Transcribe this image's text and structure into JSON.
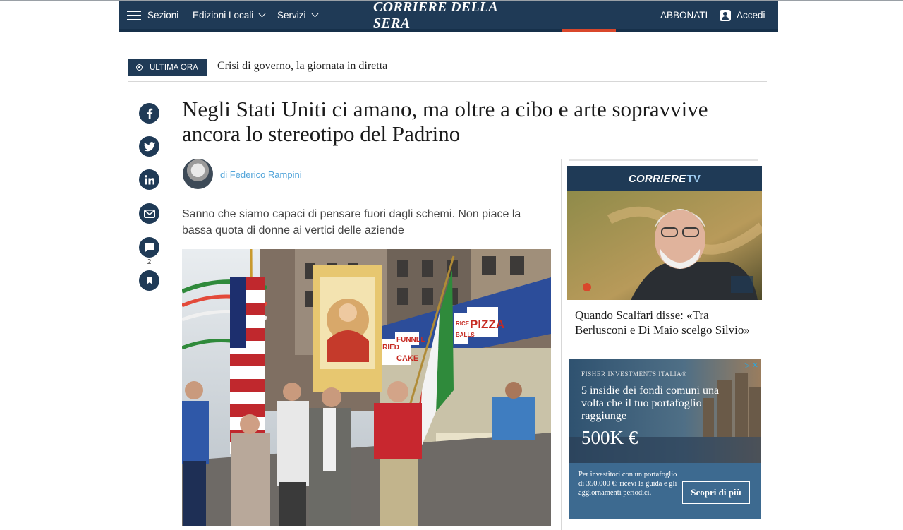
{
  "header": {
    "menu_label": "Sezioni",
    "nav": [
      {
        "label": "Edizioni Locali"
      },
      {
        "label": "Servizi"
      }
    ],
    "logo": "CORRIERE DELLA SERA",
    "subscribe_label": "ABBONATI",
    "login_label": "Accedi"
  },
  "breaking": {
    "badge": "ULTIMA ORA",
    "text": "Crisi di governo, la giornata in diretta"
  },
  "share": {
    "items": [
      {
        "icon": "facebook-icon"
      },
      {
        "icon": "twitter-icon"
      },
      {
        "icon": "linkedin-icon"
      },
      {
        "icon": "email-icon"
      },
      {
        "icon": "comment-icon"
      },
      {
        "icon": "bookmark-icon"
      }
    ],
    "comment_count": "2"
  },
  "article": {
    "headline": "Negli Stati Uniti ci amano, ma oltre a cibo e arte sopravvive ancora lo stereotipo del Padrino",
    "author": "di Federico Rampini",
    "summary": "Sanno che siamo capaci di pensare fuori dagli schemi. Non piace la bassa quota di donne ai vertici delle aziende",
    "photo_signs": [
      "FRIED",
      "FUNNEL",
      "CAKE",
      "PIZZA",
      "RICE",
      "BALLS"
    ]
  },
  "sidebar": {
    "tv_brand": "CORRIERE",
    "tv_suffix": "TV",
    "tv_caption": "Quando Scalfari disse: «Tra Berlusconi e Di Maio scelgo Silvio»",
    "ad": {
      "brand": "FISHER INVESTMENTS ITALIA®",
      "headline": "5 insidie dei fondi comuni una volta che il tuo portafoglio raggiunge",
      "amount": "500K €",
      "body": "Per investitori con un portafoglio di 350.000 €: ricevi la guida e gli aggiornamenti periodici.",
      "cta": "Scopri di più",
      "adchoices": "▷ ✕"
    }
  },
  "colors": {
    "navy": "#1f3a56",
    "author_link": "#4fa3d9",
    "accent_red": "#d9472b"
  }
}
